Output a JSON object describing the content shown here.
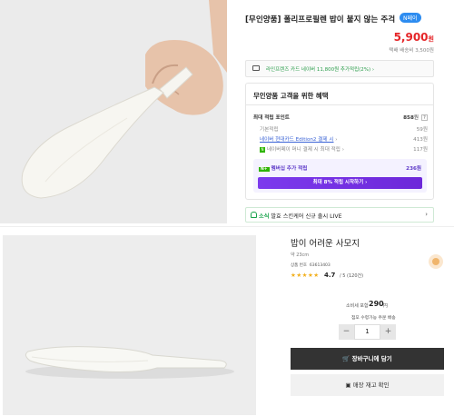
{
  "top": {
    "title": "[무인양품] 폴리프로필렌 밥이 붙지 않는 주걱",
    "npay_badge": "N페이",
    "price": "5,900",
    "price_unit": "원",
    "shipping": "택배 배송비 3,500원",
    "card_bar": "라인프렌즈 카드 네이버 11,800원 추가적립(2%)",
    "benefit_heading": "무인양품 고객을 위한 혜택",
    "max_points_label": "최대 적립 포인트",
    "max_points_value": "858",
    "max_points_unit": "원",
    "basic_label": "기본적립",
    "basic_value": "59원",
    "card_link": "네이버 현대카드 Edition2 결제 시",
    "card_value": "413원",
    "npay_money_label": "네이버페이 머니 결제 시 최대 적립",
    "npay_money_value": "117원",
    "membership_label": "멤버십 추가 적립",
    "membership_badge": "N+",
    "membership_value": "236원",
    "membership_button": "최대 8% 적립 시작하기",
    "news_tag": "소식",
    "news_text": "발효 스킨케어 신규 출시 LIVE"
  },
  "bottom": {
    "title": "밥이 어려운 사모지",
    "size": "약 23cm",
    "code_label": "상품 번호",
    "code_value": "63613403",
    "stars": "★★★★★",
    "rating": "4.7",
    "reviews": "(120건)",
    "price_label": "소비세 포함",
    "price_value": "290",
    "price_unit": "円",
    "stock_label": "점포 수령가능 주문 배송",
    "qty_minus": "−",
    "qty_value": "1",
    "qty_plus": "+",
    "cart_button": "장바구니에 담기",
    "store_button": "매장 재고 확인"
  },
  "colors": {
    "price_red": "#e52528",
    "membership_purple": "#6d28d9",
    "news_green": "#17a34a"
  }
}
